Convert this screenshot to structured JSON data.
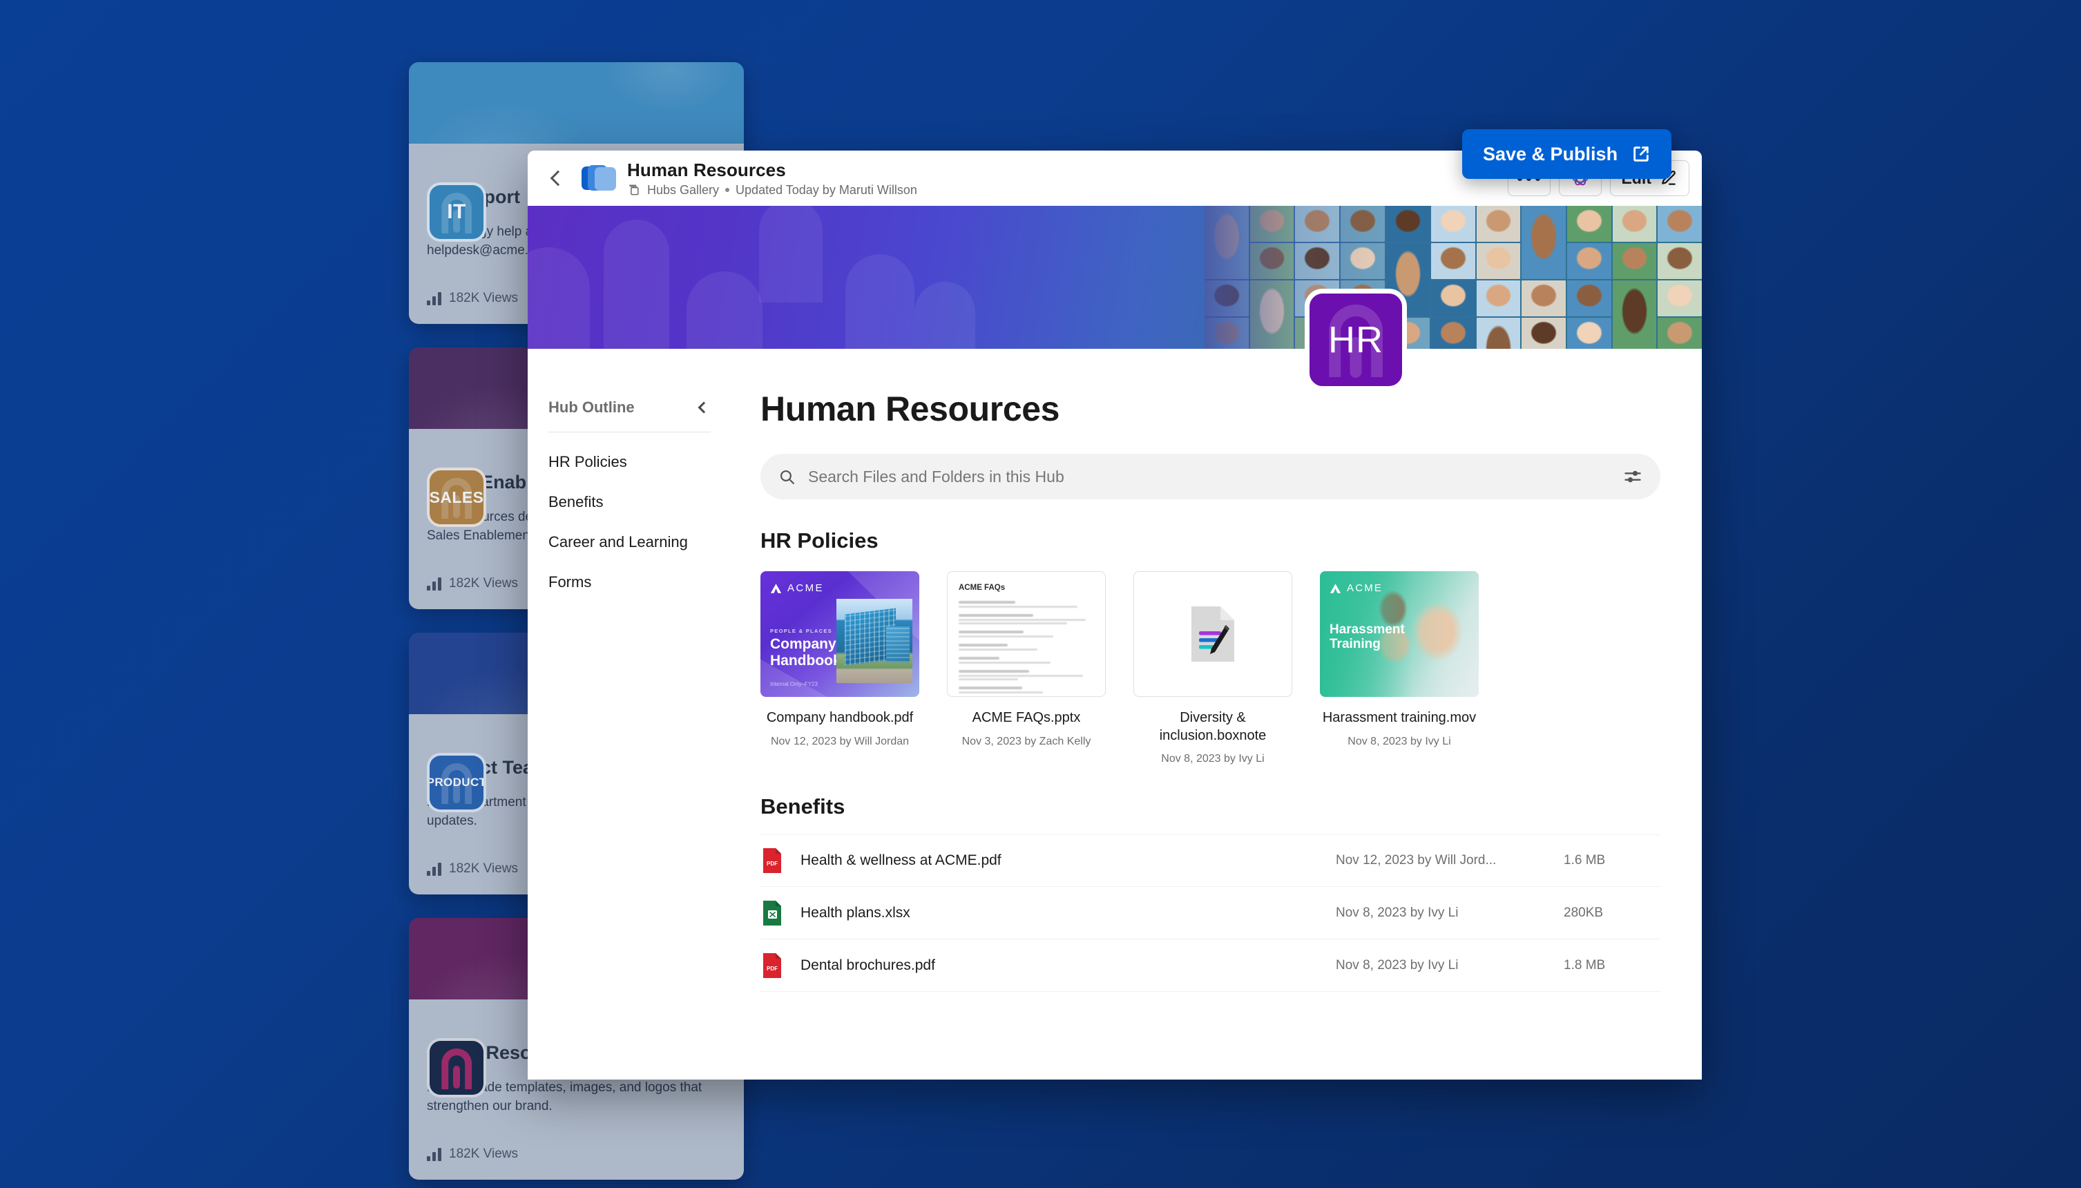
{
  "background": {
    "cards": [
      {
        "icon_label": "IT",
        "icon_bg": "#1f8fd6",
        "banner_bg": "#2a96db",
        "title": "IT Support",
        "description": "Technology help and support. Reach us at helpdesk@acme.com.",
        "views": "182K Views"
      },
      {
        "icon_label": "SALES",
        "icon_bg": "#c98326",
        "banner_bg": "#5b2a70",
        "title": "Sales Enablement",
        "description": "With resources designed to drive revenue, the Sales Enablement Hub empowers sales teams.",
        "views": "182K Views"
      },
      {
        "icon_label": "PRODUCT",
        "icon_bg": "#1767cf",
        "banner_bg": "#1b45b0",
        "title": "Product Team",
        "description": "Build department knowledge and share product updates.",
        "views": "182K Views"
      },
      {
        "icon_label": "",
        "icon_bg": "#152a54",
        "banner_bg": "#7a2070",
        "title": "Brand Resources",
        "description": "Ready-made templates, images, and logos that strengthen our brand.",
        "views": "182K Views"
      }
    ]
  },
  "save_publish": {
    "label": "Save & Publish"
  },
  "header": {
    "title": "Human Resources",
    "breadcrumb": "Hubs Gallery",
    "separator": "•",
    "updated": "Updated Today by Maruti Willson",
    "edit_label": "Edit"
  },
  "hub": {
    "icon_label": "HR",
    "icon_bg": "#6b0fae"
  },
  "outline": {
    "title": "Hub Outline",
    "items": [
      {
        "label": "HR Policies"
      },
      {
        "label": "Benefits"
      },
      {
        "label": "Career and Learning"
      },
      {
        "label": "Forms"
      }
    ]
  },
  "main": {
    "page_title": "Human Resources",
    "search_placeholder": "Search Files and Folders in this Hub",
    "search_value": "",
    "sections": [
      {
        "title": "HR Policies",
        "type": "grid",
        "files": [
          {
            "name": "Company handbook.pdf",
            "meta": "Nov 12, 2023 by Will Jordan",
            "thumb": "handbook",
            "thumb_brand": "ACME",
            "thumb_kicker": "PEOPLE & PLACES",
            "thumb_title": "Company\nHandbook",
            "thumb_footer": "Internal Only–FY23"
          },
          {
            "name": "ACME FAQs.pptx",
            "meta": "Nov 3, 2023 by Zach Kelly",
            "thumb": "faq",
            "thumb_title": "ACME FAQs"
          },
          {
            "name": "Diversity & inclusion.boxnote",
            "meta": "Nov 8, 2023 by Ivy Li",
            "thumb": "boxnote"
          },
          {
            "name": "Harassment training.mov",
            "meta": "Nov 8, 2023 by Ivy Li",
            "thumb": "video",
            "thumb_brand": "ACME",
            "thumb_title": "Harassment\nTraining"
          }
        ]
      },
      {
        "title": "Benefits",
        "type": "list",
        "files": [
          {
            "name": "Health & wellness at ACME.pdf",
            "meta": "Nov 12, 2023 by Will Jord...",
            "size": "1.6 MB",
            "kind": "pdf"
          },
          {
            "name": "Health plans.xlsx",
            "meta": "Nov 8, 2023 by Ivy Li",
            "size": "280KB",
            "kind": "xlsx"
          },
          {
            "name": "Dental brochures.pdf",
            "meta": "Nov 8, 2023 by Ivy Li",
            "size": "1.8 MB",
            "kind": "pdf"
          }
        ]
      }
    ]
  },
  "colors": {
    "accent": "#0061d5",
    "hub_purple": "#6b0fae",
    "pdf_red": "#d9232e",
    "xlsx_green": "#197a41",
    "page_bg": "#0b3c8d"
  }
}
